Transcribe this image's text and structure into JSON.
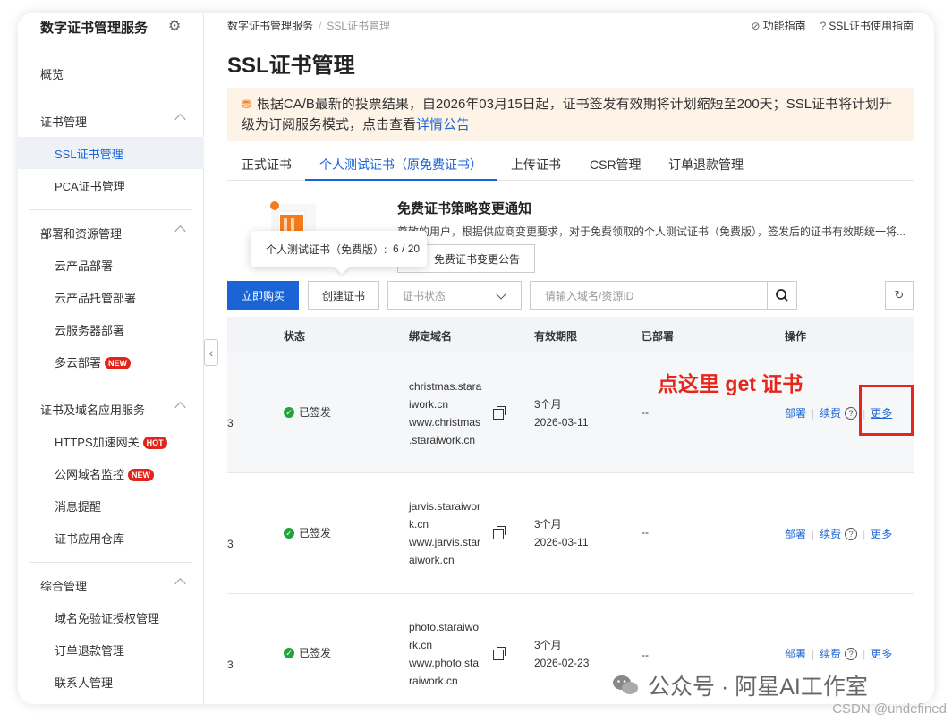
{
  "sidebar": {
    "title": "数字证书管理服务",
    "items": [
      {
        "label": "概览"
      },
      {
        "label": "证书管理"
      },
      {
        "label": "SSL证书管理"
      },
      {
        "label": "PCA证书管理"
      },
      {
        "label": "部署和资源管理"
      },
      {
        "label": "云产品部署"
      },
      {
        "label": "云产品托管部署"
      },
      {
        "label": "云服务器部署"
      },
      {
        "label": "多云部署",
        "badge": "NEW"
      },
      {
        "label": "证书及域名应用服务"
      },
      {
        "label": "HTTPS加速网关",
        "badge": "HOT"
      },
      {
        "label": "公网域名监控",
        "badge": "NEW"
      },
      {
        "label": "消息提醒"
      },
      {
        "label": "证书应用仓库"
      },
      {
        "label": "综合管理"
      },
      {
        "label": "域名免验证授权管理"
      },
      {
        "label": "订单退款管理"
      },
      {
        "label": "联系人管理"
      }
    ]
  },
  "breadcrumb": {
    "root": "数字证书管理服务",
    "separator": "/",
    "current": "SSL证书管理"
  },
  "top_links": {
    "guide": "功能指南",
    "ssl_guide": "SSL证书使用指南"
  },
  "page_title": "SSL证书管理",
  "notice": {
    "text": "根据CA/B最新的投票结果，自2026年03月15日起，证书签发有效期将计划缩短至200天；SSL证书将计划升级为订阅服务模式，点击查看",
    "link": "详情公告"
  },
  "tabs": [
    "正式证书",
    "个人测试证书（原免费证书）",
    "上传证书",
    "CSR管理",
    "订单退款管理"
  ],
  "promo": {
    "title": "免费证书策略变更通知",
    "desc": "尊敬的用户，根据供应商变更要求，对于免费领取的个人测试证书（免费版），签发后的证书有效期统一将...",
    "button": "免费证书变更公告"
  },
  "tooltip": {
    "label": "个人测试证书（免费版）:",
    "value": "6 / 20"
  },
  "toolbar": {
    "buy": "立即购买",
    "create": "创建证书",
    "status_placeholder": "证书状态",
    "search_placeholder": "请输入域名/资源ID"
  },
  "table": {
    "headers": {
      "status": "状态",
      "domain": "绑定域名",
      "validity": "有效期限",
      "deployed": "已部署",
      "actions": "操作"
    },
    "rows": [
      {
        "id_tail": "3",
        "status": "已签发",
        "domain": [
          "christmas.stara",
          "iwork.cn",
          "www.christmas",
          ".staraiwork.cn"
        ],
        "period": "3个月",
        "date": "2026-03-11",
        "deployed": "--"
      },
      {
        "id_tail": "3",
        "status": "已签发",
        "domain": [
          "jarvis.staraiwor",
          "k.cn",
          "www.jarvis.star",
          "aiwork.cn"
        ],
        "period": "3个月",
        "date": "2026-03-11",
        "deployed": "--"
      },
      {
        "id_tail": "3",
        "status": "已签发",
        "domain": [
          "photo.staraiwo",
          "rk.cn",
          "www.photo.sta",
          "raiwork.cn"
        ],
        "period": "3个月",
        "date": "2026-02-23",
        "deployed": "--"
      }
    ],
    "actions": {
      "deploy": "部署",
      "renew": "续费",
      "more": "更多"
    }
  },
  "annotation": "点这里 get 证书",
  "watermark": "公众号 · 阿星AI工作室",
  "csdn": "CSDN @undefined",
  "colors": {
    "accent": "#1a64d6",
    "annotation": "#e8251b",
    "notice_bg": "#fdf3e7",
    "success": "#22a33b"
  }
}
